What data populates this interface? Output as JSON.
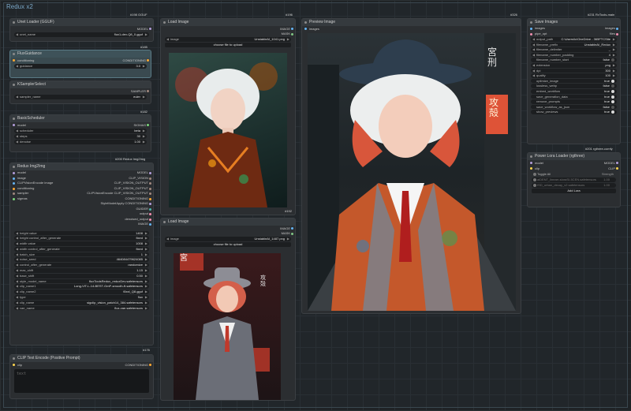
{
  "group_title": "Redux x2",
  "colors": {
    "model": "#b39ddb",
    "clip": "#ffd54f",
    "conditioning": "#ffa931",
    "image": "#64b5f6",
    "mask": "#81c784",
    "vision": "#a1887f",
    "green": "#7bd67b",
    "style": "#f48fb1",
    "guider": "#4db6ac"
  },
  "unet": {
    "tag": "#198 GGUF",
    "title": "Unet Loader (GGUF)",
    "out": "MODEL",
    "w_label": "unet_name",
    "w_value": "flux1-dev-Q8_0.gguf"
  },
  "flux": {
    "tag": "#185",
    "title": "FluxGuidance",
    "in": "conditioning",
    "out": "CONDITIONING",
    "w_label": "guidance",
    "w_value": "3.0"
  },
  "ksampler": {
    "title": "KSamplerSelect",
    "out": "SAMPLER",
    "w_label": "sampler_name",
    "w_value": "euler"
  },
  "sched": {
    "tag": "#182",
    "title": "BasicScheduler",
    "in": "model",
    "out": "SIGMAS",
    "widgets": [
      {
        "label": "scheduler",
        "value": "beta"
      },
      {
        "label": "steps",
        "value": "30"
      },
      {
        "label": "denoise",
        "value": "1.00"
      }
    ]
  },
  "redux": {
    "tag": "#200 Redux Img2Img",
    "title": "Redux Img2Img",
    "io": [
      {
        "l": "model",
        "r": "MODEL"
      },
      {
        "l": "image",
        "r": "CLIP_VISION"
      },
      {
        "l": "CLIPVisionEncode image",
        "r": "CLIP_VISION_OUTPUT"
      },
      {
        "l": "conditioning",
        "r": "CLIP_VISION_OUTPUT"
      },
      {
        "l": "sampler",
        "r": "CLIPVisionEncode CLIP_VISION_OUTPUT"
      },
      {
        "l": "sigmas",
        "r": "CONDITIONING"
      },
      {
        "l": "",
        "r": "StyleModelApply CONDITIONING"
      },
      {
        "l": "",
        "r": "GUIDER"
      },
      {
        "l": "",
        "r": "output"
      },
      {
        "l": "",
        "r": "denoised_output"
      },
      {
        "l": "",
        "r": "IMAGE"
      }
    ],
    "widgets": [
      {
        "label": "height value",
        "value": "1408"
      },
      {
        "label": "height control_after_generate",
        "value": "fixed"
      },
      {
        "label": "width value",
        "value": "1008"
      },
      {
        "label": "width control_after_generate",
        "value": "fixed"
      },
      {
        "label": "batch_size",
        "value": "1"
      },
      {
        "label": "noise_seed",
        "value": "464084479624085"
      },
      {
        "label": "control_after_generate",
        "value": "randomize"
      },
      {
        "label": "max_shift",
        "value": "1.15"
      },
      {
        "label": "base_shift",
        "value": "0.50"
      },
      {
        "label": "style_model_name",
        "value": "fluxToolsRedux_reduxDev.safetensors"
      },
      {
        "label": "clip_name1",
        "value": "Long-ViT-L-14-BEST-GmP-smooth-ft.safetensors"
      },
      {
        "label": "clip_name2",
        "value": "t5xxl_Q8.gguf"
      },
      {
        "label": "type",
        "value": "flux"
      },
      {
        "label": "clip_name",
        "value": "sigclip_vision_patch14_384.safetensors"
      },
      {
        "label": "vae_name",
        "value": "flux-vae.safetensors"
      }
    ]
  },
  "clip_text": {
    "tag": "#176",
    "title": "CLIP Text Encode (Positive Prompt)",
    "in": "clip",
    "out": "CONDITIONING",
    "placeholder": "text"
  },
  "load1": {
    "tag": "#196",
    "title": "Load Image",
    "outs": [
      "IMAGE",
      "MASK"
    ],
    "w_label": "image",
    "w_value": "UnstableAI_1041.png",
    "btn": "choose file to upload",
    "bottom_tag": "#192"
  },
  "load2": {
    "title": "Load Image",
    "outs": [
      "IMAGE",
      "MASK"
    ],
    "w_label": "image",
    "w_value": "UnstableAI_1487.png",
    "btn": "choose file to upload"
  },
  "preview": {
    "tag": "#326",
    "title": "Preview Image",
    "in": "images",
    "sign_top": "宮\n刑",
    "sign_neon": "攻\n殻"
  },
  "save": {
    "tag": "#231 RvTools-main",
    "title": "Save Images",
    "io": [
      {
        "l": "images",
        "r": "images"
      },
      {
        "l": "pipe_opt",
        "r": "files"
      }
    ],
    "widgets": [
      {
        "label": "output_path",
        "value": "C:\\Users\\lc\\OneDrive - 365FTCSite"
      },
      {
        "label": "filename_prefix",
        "value": "UnstableAI_Redux"
      },
      {
        "label": "filename_delimiter",
        "value": "_"
      },
      {
        "label": "filename_number_padding",
        "value": "4"
      },
      {
        "label": "filename_number_start",
        "value": "false"
      },
      {
        "label": "extension",
        "value": "png"
      },
      {
        "label": "dpi",
        "value": "300"
      },
      {
        "label": "quality",
        "value": "100"
      },
      {
        "label": "optimize_image",
        "value": "true"
      },
      {
        "label": "lossless_webp",
        "value": "false"
      },
      {
        "label": "embed_workflow",
        "value": "true"
      },
      {
        "label": "save_generation_data",
        "value": "true"
      },
      {
        "label": "remove_prompts",
        "value": "true"
      },
      {
        "label": "save_workflow_as_json",
        "value": "false"
      },
      {
        "label": "show_previews",
        "value": "true"
      }
    ]
  },
  "lora": {
    "tag": "#201 rgthree-comfy",
    "title": "Power Lora Loader (rgthree)",
    "io": [
      {
        "l": "model",
        "r": "MODEL"
      },
      {
        "l": "clip",
        "r": "CLIP"
      }
    ],
    "toggle_label": "Toggle All",
    "strength_label": "Strength",
    "loras": [
      {
        "name": "aiDENT_linearr-sloraSI-5CEN.safetensors",
        "value": "1.00"
      },
      {
        "name": "ISD_urban_decay_v2.safetensors",
        "value": "1.00"
      }
    ],
    "add": "Add Lora"
  },
  "img1_sign": "",
  "img2_sign": "攻\n殻",
  "img2_sign2": "宮"
}
